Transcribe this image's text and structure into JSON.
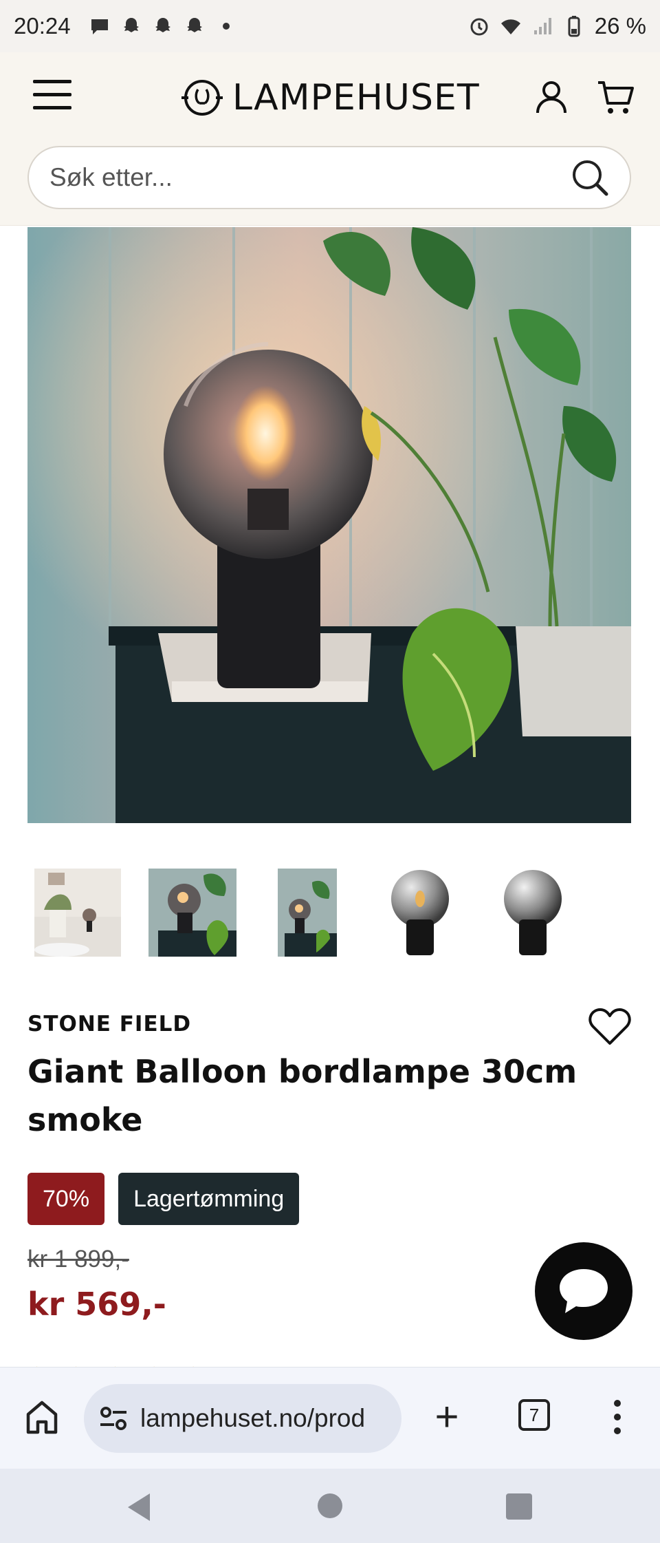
{
  "status_bar": {
    "time": "20:24",
    "battery": "26 %",
    "icons": [
      "chat-icon",
      "snapchat-icon",
      "snapchat-icon",
      "snapchat-icon",
      "dot-icon",
      "alarm-icon",
      "wifi-icon",
      "signal-icon",
      "battery-icon"
    ]
  },
  "header": {
    "logo_text": "LAMPEHUSET",
    "search_placeholder": "Søk etter..."
  },
  "thumbnails": [
    {
      "label": "living-room-scene"
    },
    {
      "label": "lamp-on-shelf"
    },
    {
      "label": "lamp-on-shelf-wide"
    },
    {
      "label": "smoke-globe-product"
    },
    {
      "label": "smoke-globe-product-alt"
    }
  ],
  "product": {
    "brand": "STONE FIELD",
    "title": "Giant Balloon bordlampe 30cm smoke",
    "discount_badge": "70%",
    "clearance_badge": "Lagertømming",
    "old_price": "kr 1 899,-",
    "price": "kr 569,-"
  },
  "browser": {
    "url": "lampehuset.no/prod",
    "tab_count": "7"
  },
  "colors": {
    "sale_red": "#8e1b1e",
    "header_bg": "#f8f5ef",
    "badge_dark": "#1e2a2e",
    "star_gold": "#e9b64a"
  }
}
